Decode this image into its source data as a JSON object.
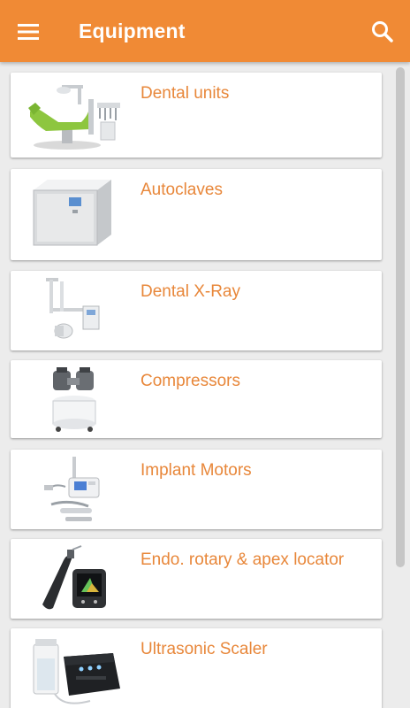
{
  "appbar": {
    "title": "Equipment",
    "menu_icon": "hamburger-menu-icon",
    "search_icon": "search-icon",
    "color": "#f08a35"
  },
  "list": {
    "label_color": "#e8873a",
    "items": [
      {
        "label": "Dental units",
        "icon": "dental-chair-image"
      },
      {
        "label": "Autoclaves",
        "icon": "autoclave-image"
      },
      {
        "label": "Dental X-Ray",
        "icon": "xray-unit-image"
      },
      {
        "label": "Compressors",
        "icon": "compressor-image"
      },
      {
        "label": "Implant Motors",
        "icon": "implant-motor-image"
      },
      {
        "label": "Endo. rotary & apex locator",
        "icon": "endo-motor-image"
      },
      {
        "label": "Ultrasonic Scaler",
        "icon": "ultrasonic-scaler-image"
      }
    ]
  }
}
